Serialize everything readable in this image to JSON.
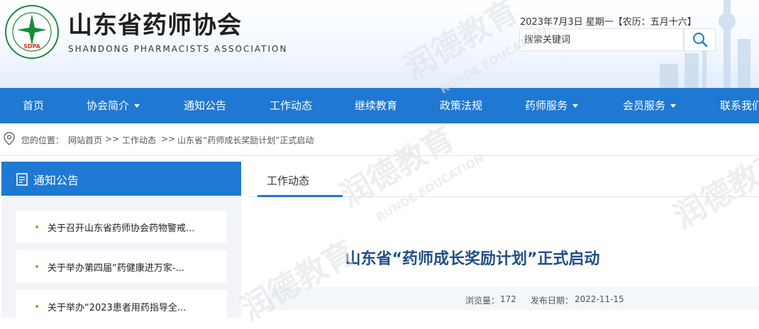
{
  "header": {
    "title": "山东省药师协会",
    "subtitle": "SHANDONG PHARMACISTS ASSOCIATION",
    "logo_text": "SDPA",
    "logo_ring_text": "山东省药师协会 SHANDONG PHARMACISTS ASSOCIATION",
    "date_line": "2023年7月3日 星期一【农历：五月十六】",
    "search_placeholder": "搜索关键词"
  },
  "nav": [
    {
      "label": "首页",
      "dropdown": false
    },
    {
      "label": "协会简介",
      "dropdown": true
    },
    {
      "label": "通知公告",
      "dropdown": false
    },
    {
      "label": "工作动态",
      "dropdown": false
    },
    {
      "label": "继续教育",
      "dropdown": false
    },
    {
      "label": "政策法规",
      "dropdown": false
    },
    {
      "label": "药师服务",
      "dropdown": true
    },
    {
      "label": "会员服务",
      "dropdown": true
    },
    {
      "label": "联系我们",
      "dropdown": false
    }
  ],
  "breadcrumb": {
    "prefix": "您的位置：",
    "items": [
      "网站首页",
      ">>",
      "工作动态",
      ">>",
      "山东省“药师成长奖励计划”正式启动"
    ]
  },
  "sidebar": {
    "title": "通知公告",
    "items": [
      "关于召开山东省药师协会药物警戒...",
      "关于举办第四届“药健康进万家-...",
      "关于举办“2023患者用药指导全..."
    ]
  },
  "main": {
    "tab": "工作动态",
    "article_title": "山东省“药师成长奖励计划”正式启动",
    "views_label": "浏览量：",
    "views": "172",
    "date_label": "发布日期：",
    "date": "2022-11-15"
  },
  "watermark": {
    "text": "润德教育",
    "sub": "RUNDE EDUCATION"
  },
  "colors": {
    "nav_bg": "#1f78d1",
    "article_title": "#1f4e86",
    "bullet": "#e8870a",
    "logo_green": "#1a8a3a",
    "logo_red": "#c0392b"
  }
}
